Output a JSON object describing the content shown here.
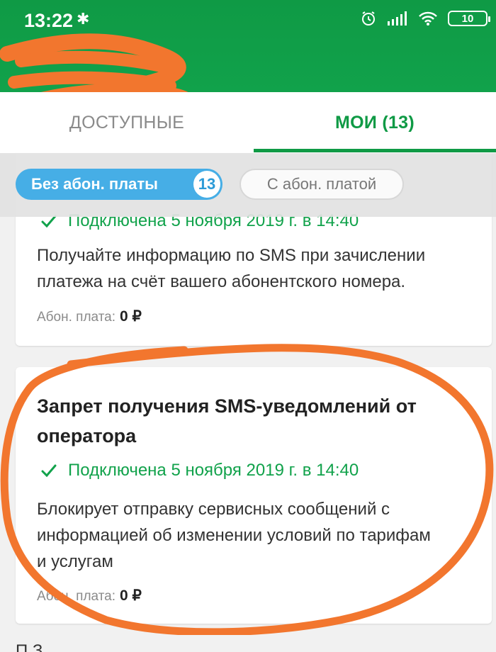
{
  "status": {
    "time": "13:22",
    "bt": "✱",
    "battery": "10"
  },
  "tabs": [
    {
      "label": "ДОСТУПНЫЕ",
      "active": false
    },
    {
      "label": "МОИ (13)",
      "active": true
    }
  ],
  "filters": {
    "free": {
      "label": "Без абон. платы",
      "count": "13",
      "active": true
    },
    "paid": {
      "label": "С абон. платой",
      "active": false
    }
  },
  "services": [
    {
      "title": "",
      "connected": "Подключена 5 ноября 2019 г. в 14:40",
      "description": "Получайте информацию по SMS при зачислении платежа на счёт вашего абонентского номера.",
      "fee_label": "Абон. плата:",
      "fee_value": "0 ₽"
    },
    {
      "title": "Запрет получения SMS-уведомлений от оператора",
      "connected": "Подключена 5 ноября 2019 г. в 14:40",
      "description": "Блокирует отправку сервисных сообщений с информацией об изменении условий по тарифам и услугам",
      "fee_label": "Абон. плата:",
      "fee_value": "0 ₽"
    }
  ],
  "next_card_partial": "П                  З",
  "colors": {
    "brand_green": "#0f9a45",
    "chip_blue": "#46aee6",
    "annotation_orange": "#f2762e"
  }
}
